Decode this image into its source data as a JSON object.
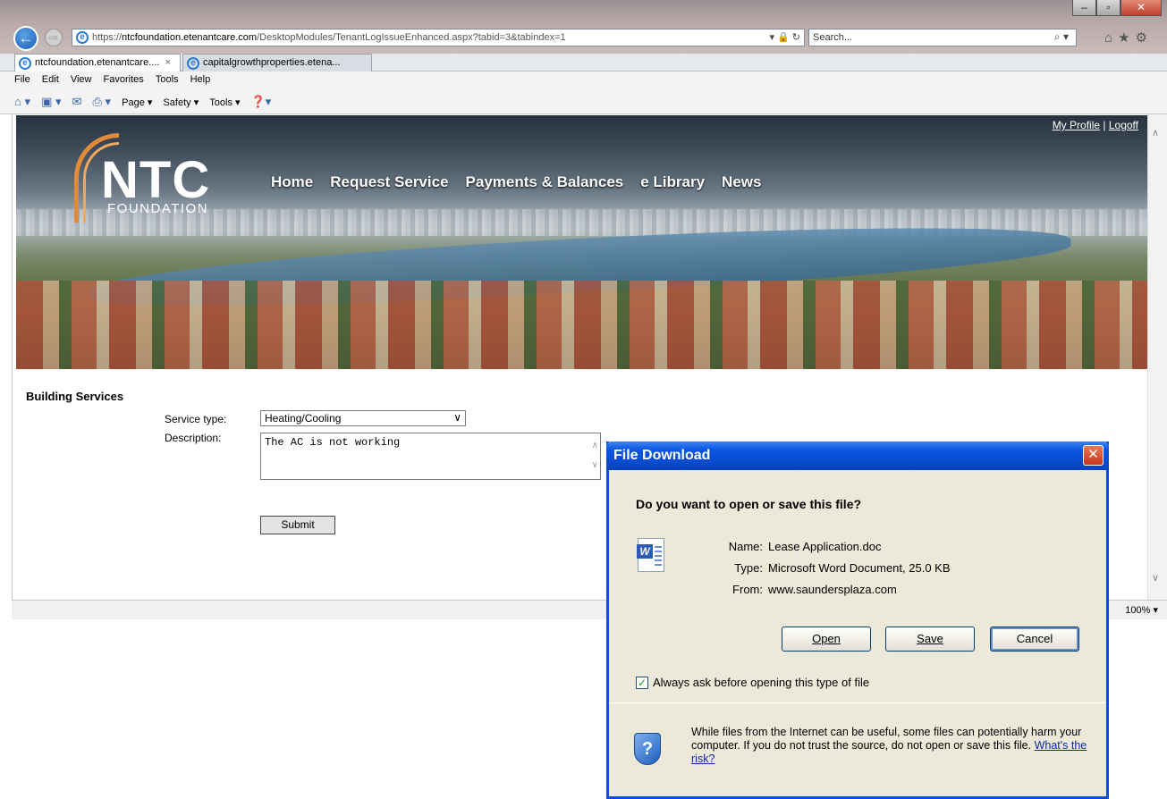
{
  "browser": {
    "url_prefix": "https://",
    "url_domain": "ntcfoundation.etenantcare.com",
    "url_path": "/DesktopModules/TenantLogIssueEnhanced.aspx?tabid=3&tabindex=1",
    "addr_controls": "▾ 🔒 ↻",
    "search_placeholder": "Search...",
    "tabs": [
      {
        "label": "ntcfoundation.etenantcare....",
        "close": "×"
      },
      {
        "label": "capitalgrowthproperties.etena..."
      }
    ],
    "menu": [
      "File",
      "Edit",
      "View",
      "Favorites",
      "Tools",
      "Help"
    ],
    "commands": [
      "Page ▾",
      "Safety ▾",
      "Tools ▾"
    ],
    "zoom": "100%"
  },
  "site": {
    "logo_text": "NTC",
    "logo_sub": "FOUNDATION",
    "nav": [
      "Home",
      "Request Service",
      "Payments & Balances",
      "e Library",
      "News"
    ],
    "my_profile": "My Profile",
    "separator": "|",
    "logoff": "Logoff"
  },
  "form": {
    "section_title": "Building Services",
    "service_type_label": "Service type:",
    "service_type_value": "Heating/Cooling",
    "description_label": "Description:",
    "description_value": "The AC is not working",
    "submit_label": "Submit"
  },
  "dialog": {
    "title": "File Download",
    "question": "Do you want to open or save this file?",
    "name_key": "Name:",
    "name_value": "Lease Application.doc",
    "type_key": "Type:",
    "type_value": "Microsoft Word Document, 25.0 KB",
    "from_key": "From:",
    "from_value": "www.saundersplaza.com",
    "open_label": "Open",
    "save_label": "Save",
    "cancel_label": "Cancel",
    "always_ask_checked": true,
    "always_ask_label": "Always ask before opening this type of file",
    "warning_text": "While files from the Internet can be useful, some files can potentially harm your computer. If you do not trust the source, do not open or save this file.",
    "risk_link": "What's the risk?"
  },
  "colors": {
    "dialog_title_blue": "#0b55e4",
    "dialog_body": "#ece9d8",
    "logo_orange": "#e08b3a"
  }
}
